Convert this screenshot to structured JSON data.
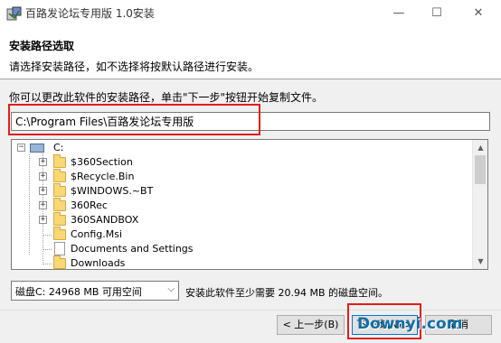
{
  "window": {
    "title": "百路发论坛专用版 1.0安装",
    "controls": {
      "minimize": "—",
      "maximize": "☐",
      "close": "✕"
    }
  },
  "header": {
    "title": "安装路径选取",
    "subtitle": "请选择安装路径，如不选择将按默认路径进行安装。"
  },
  "instruction": "你可以更改此软件的安装路径，单击\"下一步\"按钮开始复制文件。",
  "path_input": {
    "value": "C:\\Program Files\\百路发论坛专用版"
  },
  "tree": {
    "root": {
      "label": "C:",
      "expander": "−"
    },
    "items": [
      {
        "label": "$360Section",
        "type": "folder",
        "expandable": true
      },
      {
        "label": "$Recycle.Bin",
        "type": "folder",
        "expandable": true
      },
      {
        "label": "$WINDOWS.~BT",
        "type": "folder",
        "expandable": true
      },
      {
        "label": "360Rec",
        "type": "folder",
        "expandable": true
      },
      {
        "label": "360SANDBOX",
        "type": "folder",
        "expandable": true
      },
      {
        "label": "Config.Msi",
        "type": "folder",
        "expandable": false
      },
      {
        "label": "Documents and Settings",
        "type": "file",
        "expandable": false
      },
      {
        "label": "Downloads",
        "type": "folder",
        "expandable": false
      }
    ],
    "expander_plus": "+"
  },
  "drive_select": {
    "value": "磁盘C:   24968 MB 可用空间",
    "arrow": "⌵"
  },
  "space_required": "安装此软件至少需要 20.94 MB 的磁盘空间。",
  "buttons": {
    "back": "< 上一步(B)",
    "next": "下一步(N) >",
    "cancel": "取消"
  },
  "scroll": {
    "up": "▲",
    "down": "▼"
  },
  "watermark": "Downyi.com",
  "colors": {
    "highlight": "#e21d1d",
    "accent": "#0078d7",
    "folder": "#f8d775"
  }
}
